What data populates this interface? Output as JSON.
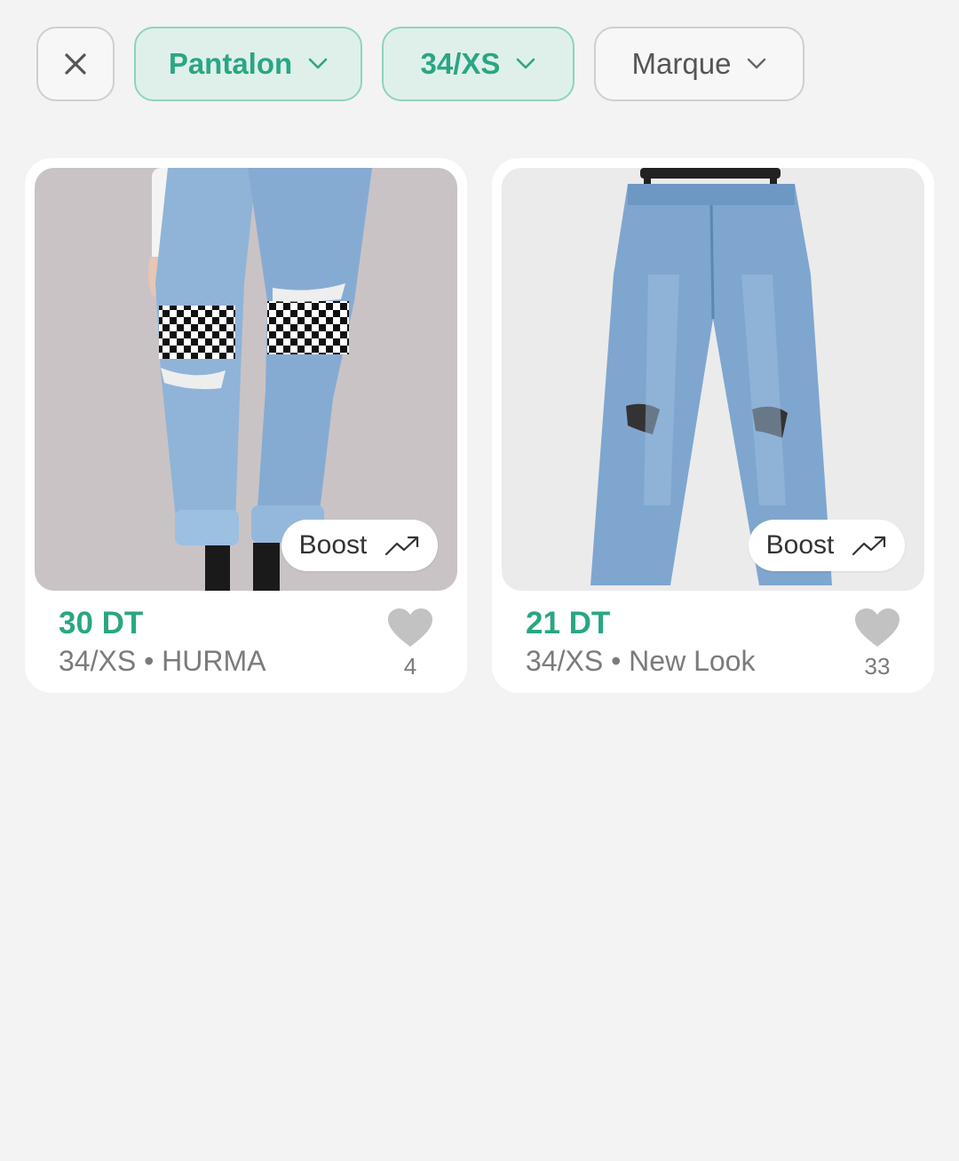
{
  "filters": {
    "close_icon": "close-icon",
    "chips": [
      {
        "label": "Pantalon",
        "active": true
      },
      {
        "label": "34/XS",
        "active": true
      },
      {
        "label": "Marque",
        "active": false
      }
    ]
  },
  "colors": {
    "accent": "#2aa684",
    "chip_active_bg": "#dff0ea",
    "chip_active_border": "#8fd3bc",
    "background": "#f3f3f3",
    "muted_text": "#7b7b7b",
    "heart": "#c2c2c2"
  },
  "products": [
    {
      "price": "30 DT",
      "size": "34/XS",
      "separator": "•",
      "brand": "HURMA",
      "likes": "4",
      "boost_label": "Boost",
      "boost_icon": "trending-up-icon"
    },
    {
      "price": "21 DT",
      "size": "34/XS",
      "separator": "•",
      "brand": "New Look",
      "likes": "33",
      "boost_label": "Boost",
      "boost_icon": "trending-up-icon"
    }
  ]
}
